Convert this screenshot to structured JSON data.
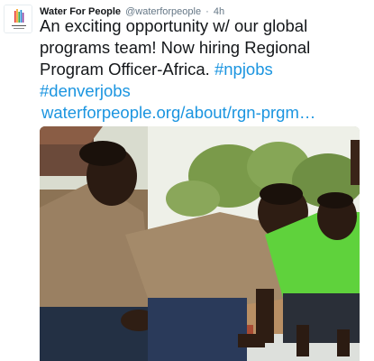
{
  "tweet": {
    "author_name": "Water For People",
    "handle": "@waterforpeople",
    "separator": "·",
    "time": "4h",
    "text_line1": "An exciting opportunity w/ our global",
    "text_line2": "programs team! Now hiring Regional",
    "text_line3_plain": "Program Officer-Africa. ",
    "hashtag1": "#npjobs",
    "hashtag2": "#denverjobs",
    "link": "waterforpeople.org/about/rgn-prgm…"
  },
  "icons": {
    "avatar": "water-for-people-logo-icon"
  },
  "colors": {
    "link": "#1b95e0",
    "text": "#14171a",
    "meta": "#657786"
  }
}
